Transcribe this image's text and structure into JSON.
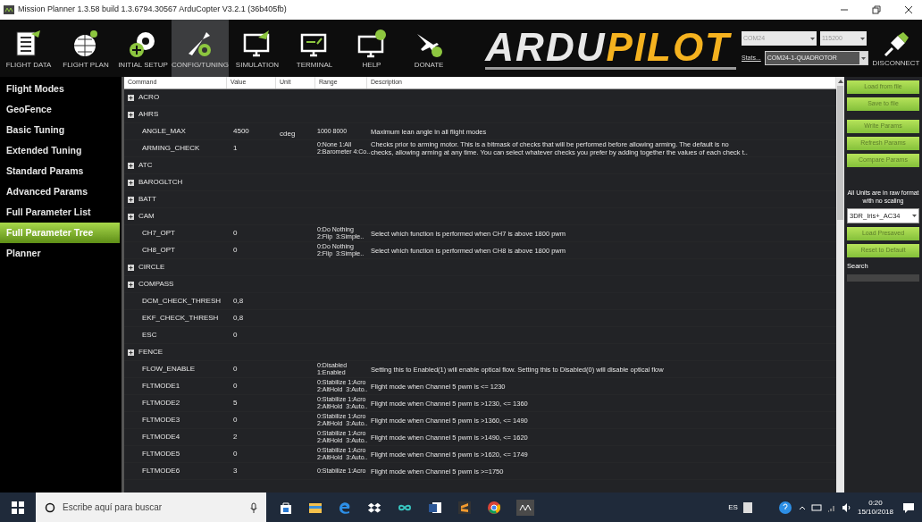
{
  "window": {
    "title": "Mission Planner 1.3.58 build 1.3.6794.30567 ArduCopter V3.2.1 (36b405fb)"
  },
  "toolbar": [
    {
      "label": "FLIGHT DATA",
      "kind": "data",
      "selected": false
    },
    {
      "label": "FLIGHT PLAN",
      "kind": "plan",
      "selected": false
    },
    {
      "label": "INITIAL SETUP",
      "kind": "setup",
      "selected": false
    },
    {
      "label": "CONFIG/TUNING",
      "kind": "config",
      "selected": true
    },
    {
      "label": "SIMULATION",
      "kind": "sim",
      "selected": false
    },
    {
      "label": "TERMINAL",
      "kind": "terminal",
      "selected": false
    },
    {
      "label": "HELP",
      "kind": "help",
      "selected": false
    },
    {
      "label": "DONATE",
      "kind": "donate",
      "selected": false
    }
  ],
  "logo": {
    "part_1": "ARDU",
    "part_2": "PILOT"
  },
  "connection": {
    "port": "COM24",
    "baud": "115200",
    "stats_link": "Stats...",
    "vehicle": "COM24-1-QUADROTOR",
    "disconnect_label": "DISCONNECT"
  },
  "sidebar": {
    "items": [
      {
        "label": "Flight Modes",
        "selected": false
      },
      {
        "label": "GeoFence",
        "selected": false
      },
      {
        "label": "Basic Tuning",
        "selected": false
      },
      {
        "label": "Extended Tuning",
        "selected": false
      },
      {
        "label": "Standard Params",
        "selected": false
      },
      {
        "label": "Advanced Params",
        "selected": false
      },
      {
        "label": "Full Parameter List",
        "selected": false
      },
      {
        "label": "Full Parameter Tree",
        "selected": true
      },
      {
        "label": "Planner",
        "selected": false
      }
    ]
  },
  "table": {
    "columns": [
      "Command",
      "Value",
      "Unit",
      "Range",
      "Description"
    ],
    "groups": [
      {
        "name": "ACRO"
      },
      {
        "name": "AHRS",
        "children": [
          {
            "command": "ANGLE_MAX",
            "value": "4500",
            "unit": "cdeg",
            "range": [
              "1000 8000"
            ],
            "description": [
              "Maximum lean angle in all flight modes"
            ]
          },
          {
            "command": "ARMING_CHECK",
            "value": "1",
            "range": [
              "0:None 1:All",
              "2:Barometer 4:Co.."
            ],
            "description": [
              "Checks prior to arming motor. This is a bitmask of checks that will be performed before allowing arming. The default is no",
              "checks, allowing arming at any time. You can select whatever checks you prefer by adding together the values of each check t.."
            ]
          }
        ]
      },
      {
        "name": "ATC"
      },
      {
        "name": "BAROGLTCH"
      },
      {
        "name": "BATT"
      },
      {
        "name": "CAM",
        "children": [
          {
            "command": "CH7_OPT",
            "value": "0",
            "range": [
              "0:Do Nothing",
              "2:Flip  3:Simple.."
            ],
            "description": [
              "Select which function is performed when CH7 is above 1800 pwm"
            ]
          },
          {
            "command": "CH8_OPT",
            "value": "0",
            "range": [
              "0:Do Nothing",
              "2:Flip  3:Simple.."
            ],
            "description": [
              "Select which function is performed when CH8 is above 1800 pwm"
            ]
          }
        ]
      },
      {
        "name": "CIRCLE"
      },
      {
        "name": "COMPASS",
        "children": [
          {
            "command": "DCM_CHECK_THRESH",
            "value": "0,8"
          },
          {
            "command": "EKF_CHECK_THRESH",
            "value": "0,8"
          },
          {
            "command": "ESC",
            "value": "0"
          }
        ]
      },
      {
        "name": "FENCE",
        "children": [
          {
            "command": "FLOW_ENABLE",
            "value": "0",
            "range": [
              "0:Disabled",
              "1:Enabled"
            ],
            "description": [
              "Setting this to Enabled(1) will enable optical flow. Setting this to Disabled(0) will disable optical flow"
            ]
          },
          {
            "command": "FLTMODE1",
            "value": "0",
            "range": [
              "0:Stabilize 1:Acro",
              "2:AltHold  3:Auto.."
            ],
            "description": [
              "Flight mode when Channel 5 pwm is <= 1230"
            ]
          },
          {
            "command": "FLTMODE2",
            "value": "5",
            "range": [
              "0:Stabilize 1:Acro",
              "2:AltHold  3:Auto.."
            ],
            "description": [
              "Flight mode when Channel 5 pwm is >1230, <= 1360"
            ]
          },
          {
            "command": "FLTMODE3",
            "value": "0",
            "range": [
              "0:Stabilize 1:Acro",
              "2:AltHold  3:Auto.."
            ],
            "description": [
              "Flight mode when Channel 5 pwm is >1360, <= 1490"
            ]
          },
          {
            "command": "FLTMODE4",
            "value": "2",
            "range": [
              "0:Stabilize 1:Acro",
              "2:AltHold  3:Auto.."
            ],
            "description": [
              "Flight mode when Channel 5 pwm is >1490, <= 1620"
            ]
          },
          {
            "command": "FLTMODE5",
            "value": "0",
            "range": [
              "0:Stabilize 1:Acro",
              "2:AltHold  3:Auto.."
            ],
            "description": [
              "Flight mode when Channel 5 pwm is >1620, <= 1749"
            ]
          },
          {
            "command": "FLTMODE6",
            "value": "3",
            "range": [
              "0:Stabilize 1:Acro"
            ],
            "description": [
              "Flight mode when Channel 5 pwm is >=1750"
            ]
          }
        ]
      }
    ]
  },
  "actions": [
    {
      "kind": "button",
      "label": "Load from file"
    },
    {
      "kind": "button",
      "label": "Save to file"
    },
    {
      "kind": "gap"
    },
    {
      "kind": "button",
      "label": "Write Params"
    },
    {
      "kind": "button",
      "label": "Refresh Params"
    },
    {
      "kind": "button",
      "label": "Compare Params"
    },
    {
      "kind": "gap"
    },
    {
      "kind": "note",
      "label": "All Units are in raw format with no scaling"
    },
    {
      "kind": "select",
      "label": "3DR_Iris+_AC34"
    },
    {
      "kind": "button",
      "label": "Load Presaved"
    },
    {
      "kind": "button",
      "label": "Reset to Default"
    },
    {
      "kind": "caption",
      "label": "Search"
    },
    {
      "kind": "field"
    }
  ],
  "taskbar": {
    "search_placeholder": "Escribe aquí para buscar",
    "apps": [
      {
        "kind": "store"
      },
      {
        "kind": "explorer"
      },
      {
        "kind": "edge"
      },
      {
        "kind": "dropbox"
      },
      {
        "kind": "infinity"
      },
      {
        "kind": "word"
      },
      {
        "kind": "sublime"
      },
      {
        "kind": "chrome"
      },
      {
        "kind": "planner"
      }
    ],
    "language": "ES",
    "time": "0:20",
    "date": "15/10/2018"
  }
}
